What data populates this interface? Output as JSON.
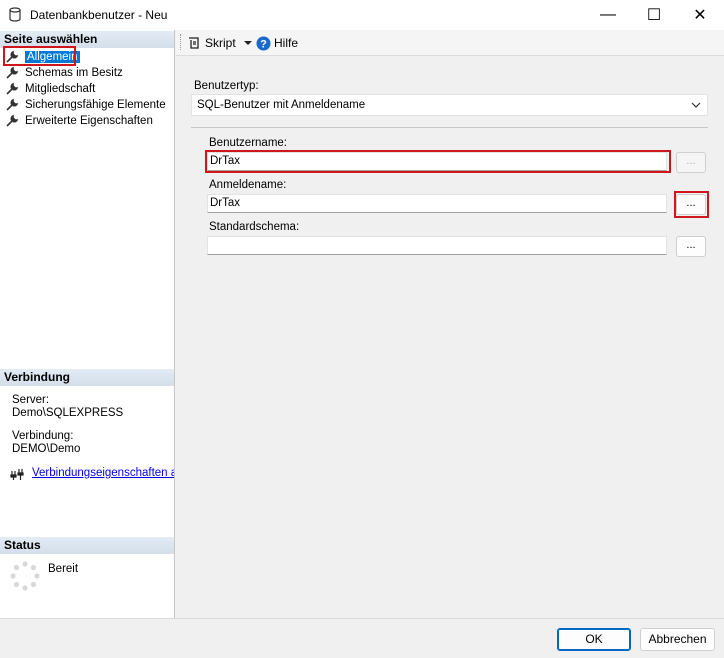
{
  "window": {
    "title": "Datenbankbenutzer - Neu",
    "minimize_glyph": "—",
    "maximize_glyph": "☐",
    "close_glyph": "✕"
  },
  "left": {
    "select_page_header": "Seite auswählen",
    "pages": [
      {
        "label": "Allgemein",
        "selected": true,
        "icon": "wrench-icon"
      },
      {
        "label": "Schemas im Besitz",
        "selected": false,
        "icon": "wrench-icon"
      },
      {
        "label": "Mitgliedschaft",
        "selected": false,
        "icon": "wrench-icon"
      },
      {
        "label": "Sicherungsfähige Elemente",
        "selected": false,
        "icon": "wrench-icon"
      },
      {
        "label": "Erweiterte Eigenschaften",
        "selected": false,
        "icon": "wrench-icon"
      }
    ],
    "connection_header": "Verbindung",
    "server_label": "Server:",
    "server_value": "Demo\\SQLEXPRESS",
    "connection_label": "Verbindung:",
    "connection_value": "DEMO\\Demo",
    "connection_link": "Verbindungseigenschaften anzeigen",
    "status_header": "Status",
    "status_value": "Bereit"
  },
  "toolbar": {
    "script_label": "Skript",
    "help_label": "Hilfe"
  },
  "form": {
    "user_type_label": "Benutzertyp:",
    "user_type_value": "SQL-Benutzer mit Anmeldename",
    "username_label": "Benutzername:",
    "username_value": "DrTax",
    "login_label": "Anmeldename:",
    "login_value": "DrTax",
    "default_schema_label": "Standardschema:",
    "default_schema_value": "",
    "browse_label": "..."
  },
  "footer": {
    "ok_label": "OK",
    "cancel_label": "Abbrechen"
  },
  "colors": {
    "selection": "#0078d7",
    "highlight_annotation": "#d0161d",
    "link": "#0000ee"
  }
}
